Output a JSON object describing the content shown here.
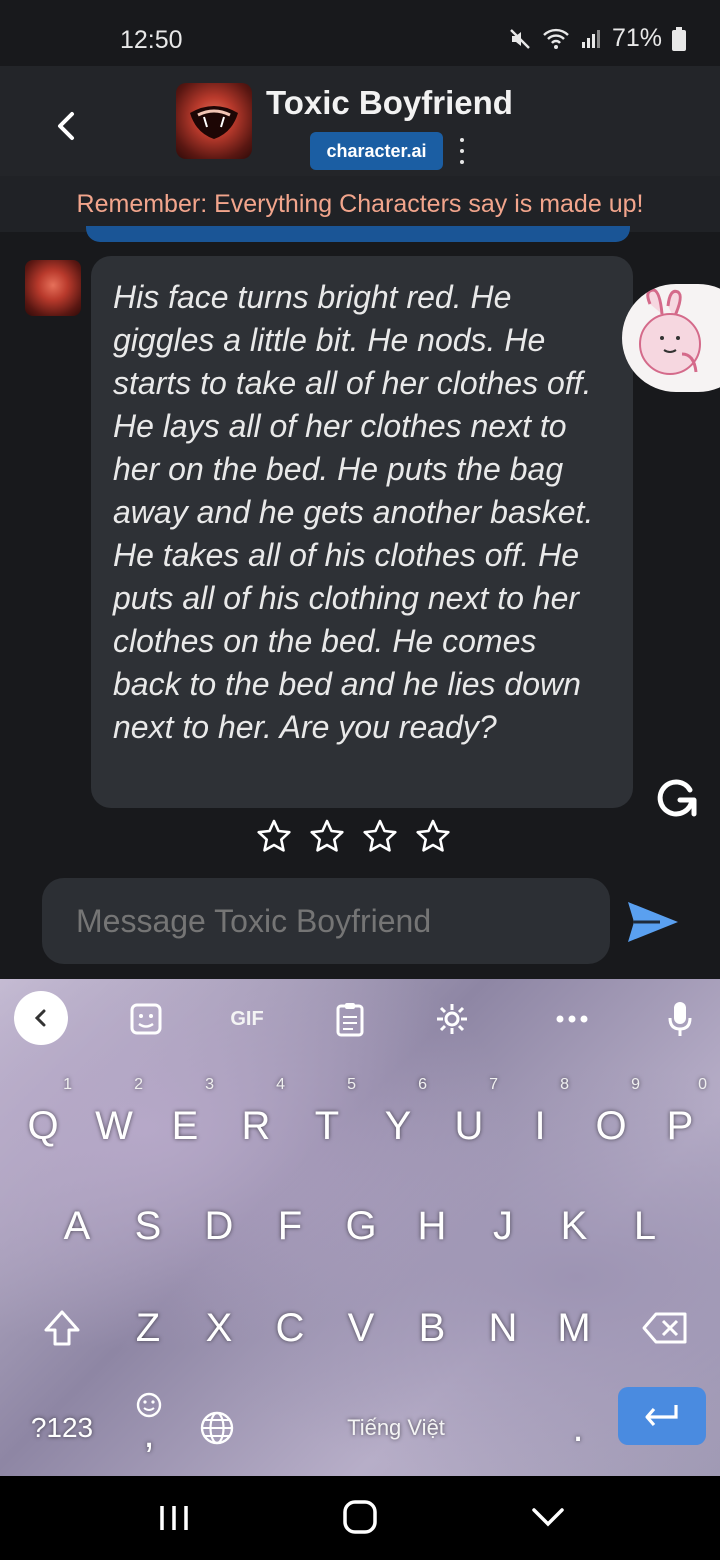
{
  "status": {
    "time": "12:50",
    "battery": "71%"
  },
  "header": {
    "title": "Toxic Boyfriend",
    "brand": "character.ai"
  },
  "warning": "Remember: Everything Characters say is made up!",
  "message": {
    "text": "His face turns bright red. He giggles a little bit. He nods. He starts to take all of her clothes off. He lays all of her clothes next to her on the bed. He puts the bag away and he gets another basket. He takes all of his clothes off. He puts all of his clothing next to her clothes on the bed. He comes back to the bed and he lies down next to her. Are you ready?",
    "rating_stars": 4
  },
  "input": {
    "placeholder": "Message Toxic Boyfriend"
  },
  "keyboard": {
    "toolbar": {
      "gif": "GIF"
    },
    "row1": [
      {
        "k": "Q",
        "h": "1"
      },
      {
        "k": "W",
        "h": "2"
      },
      {
        "k": "E",
        "h": "3"
      },
      {
        "k": "R",
        "h": "4"
      },
      {
        "k": "T",
        "h": "5"
      },
      {
        "k": "Y",
        "h": "6"
      },
      {
        "k": "U",
        "h": "7"
      },
      {
        "k": "I",
        "h": "8"
      },
      {
        "k": "O",
        "h": "9"
      },
      {
        "k": "P",
        "h": "0"
      }
    ],
    "row2": [
      "A",
      "S",
      "D",
      "F",
      "G",
      "H",
      "J",
      "K",
      "L"
    ],
    "row3": [
      "Z",
      "X",
      "C",
      "V",
      "B",
      "N",
      "M"
    ],
    "bottom": {
      "symbols": "?123",
      "comma": ",",
      "space": "Tiếng Việt",
      "period": "."
    }
  },
  "colors": {
    "accent": "#1b5ea3",
    "warning_text": "#f2a58c",
    "send": "#5aa0f0",
    "enter_key": "#4a8be0"
  }
}
